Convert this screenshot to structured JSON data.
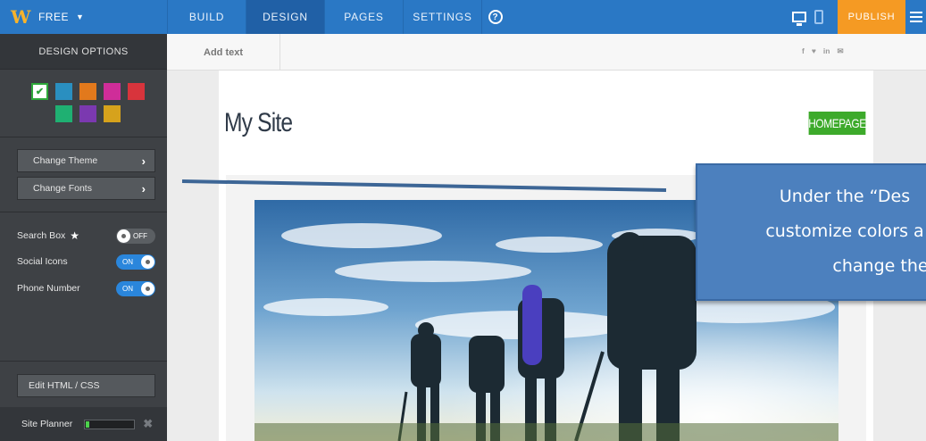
{
  "topbar": {
    "brand_label": "FREE",
    "tabs": [
      {
        "label": "BUILD",
        "active": false
      },
      {
        "label": "DESIGN",
        "active": true
      },
      {
        "label": "PAGES",
        "active": false
      },
      {
        "label": "SETTINGS",
        "active": false
      }
    ],
    "help_glyph": "?",
    "publish_label": "PUBLISH",
    "colors": {
      "bar": "#2a78c5",
      "active_tab": "#2060a6",
      "publish": "#f59a23",
      "logo": "#f7b32b"
    }
  },
  "sidebar": {
    "title": "DESIGN OPTIONS",
    "swatches": [
      {
        "color": "#2ea83a",
        "selected": true
      },
      {
        "color": "#2a8fc0",
        "selected": false
      },
      {
        "color": "#e2791c",
        "selected": false
      },
      {
        "color": "#cf2d99",
        "selected": false
      },
      {
        "color": "#d8343c",
        "selected": false
      },
      {
        "color": "#1fb072",
        "selected": false
      },
      {
        "color": "#7b39b0",
        "selected": false
      },
      {
        "color": "#d6a21c",
        "selected": false
      }
    ],
    "change_theme_label": "Change Theme",
    "change_fonts_label": "Change Fonts",
    "toggles": {
      "search_box": {
        "label": "Search Box",
        "state": "OFF",
        "on": false
      },
      "social_icons": {
        "label": "Social Icons",
        "state": "ON",
        "on": true
      },
      "phone_number": {
        "label": "Phone Number",
        "state": "ON",
        "on": true
      }
    },
    "edit_html_label": "Edit HTML / CSS",
    "site_planner": {
      "label": "Site Planner",
      "progress": 0.08
    }
  },
  "editor": {
    "add_text_label": "Add text",
    "social_icons": [
      "f",
      "♥",
      "in",
      "✉"
    ],
    "site_title": "My Site",
    "nav_item": "HOMEPAGE"
  },
  "tutorial": {
    "lines": [
      "Under the “Des",
      "customize colors a",
      "change the"
    ],
    "color": "#4c80be"
  }
}
